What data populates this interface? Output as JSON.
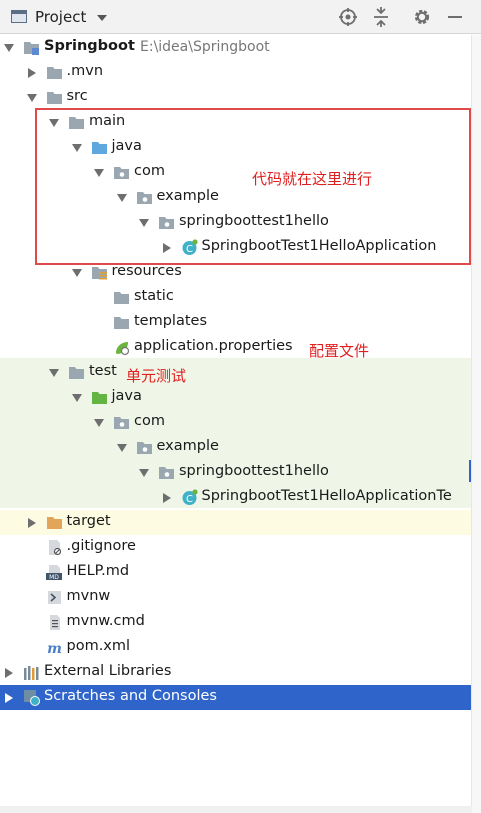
{
  "header": {
    "title": "Project",
    "buttons": [
      "locate-icon",
      "collapse-all-icon",
      "gear-icon",
      "minimize-icon"
    ]
  },
  "tree": [
    {
      "label": "Springboot",
      "path": "E:\\idea\\Springboot",
      "bold": true,
      "icon": "module-folder-icon",
      "depth": 0,
      "state": "expanded"
    },
    {
      "label": ".mvn",
      "icon": "folder-icon",
      "depth": 1,
      "state": "collapsed"
    },
    {
      "label": "src",
      "icon": "folder-icon",
      "depth": 1,
      "state": "expanded"
    },
    {
      "label": "main",
      "icon": "folder-icon",
      "depth": 2,
      "state": "expanded"
    },
    {
      "label": "java",
      "icon": "source-folder-icon",
      "depth": 3,
      "state": "expanded"
    },
    {
      "label": "com",
      "icon": "package-icon",
      "depth": 4,
      "state": "expanded"
    },
    {
      "label": "example",
      "icon": "package-icon",
      "depth": 5,
      "state": "expanded"
    },
    {
      "label": "springboottest1hello",
      "icon": "package-icon",
      "depth": 6,
      "state": "expanded"
    },
    {
      "label": "SpringbootTest1HelloApplication",
      "icon": "spring-class-icon",
      "depth": 7,
      "state": "collapsed"
    },
    {
      "label": "resources",
      "icon": "resources-folder-icon",
      "depth": 3,
      "state": "expanded"
    },
    {
      "label": "static",
      "icon": "folder-icon",
      "depth": 4,
      "state": "leaf"
    },
    {
      "label": "templates",
      "icon": "folder-icon",
      "depth": 4,
      "state": "leaf"
    },
    {
      "label": "application.properties",
      "icon": "spring-properties-icon",
      "depth": 4,
      "state": "leaf"
    },
    {
      "label": "test",
      "icon": "folder-icon",
      "depth": 2,
      "state": "expanded"
    },
    {
      "label": "java",
      "icon": "test-source-folder-icon",
      "depth": 3,
      "state": "expanded"
    },
    {
      "label": "com",
      "icon": "package-icon",
      "depth": 4,
      "state": "expanded"
    },
    {
      "label": "example",
      "icon": "package-icon",
      "depth": 5,
      "state": "expanded"
    },
    {
      "label": "springboottest1hello",
      "icon": "package-icon",
      "depth": 6,
      "state": "expanded"
    },
    {
      "label": "SpringbootTest1HelloApplicationTe",
      "icon": "spring-class-icon",
      "depth": 7,
      "state": "collapsed"
    },
    {
      "label": "target",
      "icon": "excluded-folder-icon",
      "depth": 1,
      "state": "collapsed"
    },
    {
      "label": ".gitignore",
      "icon": "gitignore-file-icon",
      "depth": 1,
      "state": "leaf"
    },
    {
      "label": "HELP.md",
      "icon": "markdown-file-icon",
      "depth": 1,
      "state": "leaf"
    },
    {
      "label": "mvnw",
      "icon": "shell-file-icon",
      "depth": 1,
      "state": "leaf"
    },
    {
      "label": "mvnw.cmd",
      "icon": "text-file-icon",
      "depth": 1,
      "state": "leaf"
    },
    {
      "label": "pom.xml",
      "icon": "maven-file-icon",
      "depth": 1,
      "state": "leaf"
    },
    {
      "label": "External Libraries",
      "icon": "libraries-icon",
      "depth": 0,
      "state": "collapsed"
    },
    {
      "label": "Scratches and Consoles",
      "icon": "scratches-icon",
      "depth": 0,
      "state": "collapsed",
      "selected": true
    }
  ],
  "annotations": {
    "code_here": "代码就在这里进行",
    "config_file": "配置文件",
    "unit_test": "单元测试"
  },
  "colors": {
    "selection": "#2f65ca",
    "test_band": "#eff6e8",
    "excluded_band": "#fdfce2",
    "annotation": "#e02020"
  }
}
